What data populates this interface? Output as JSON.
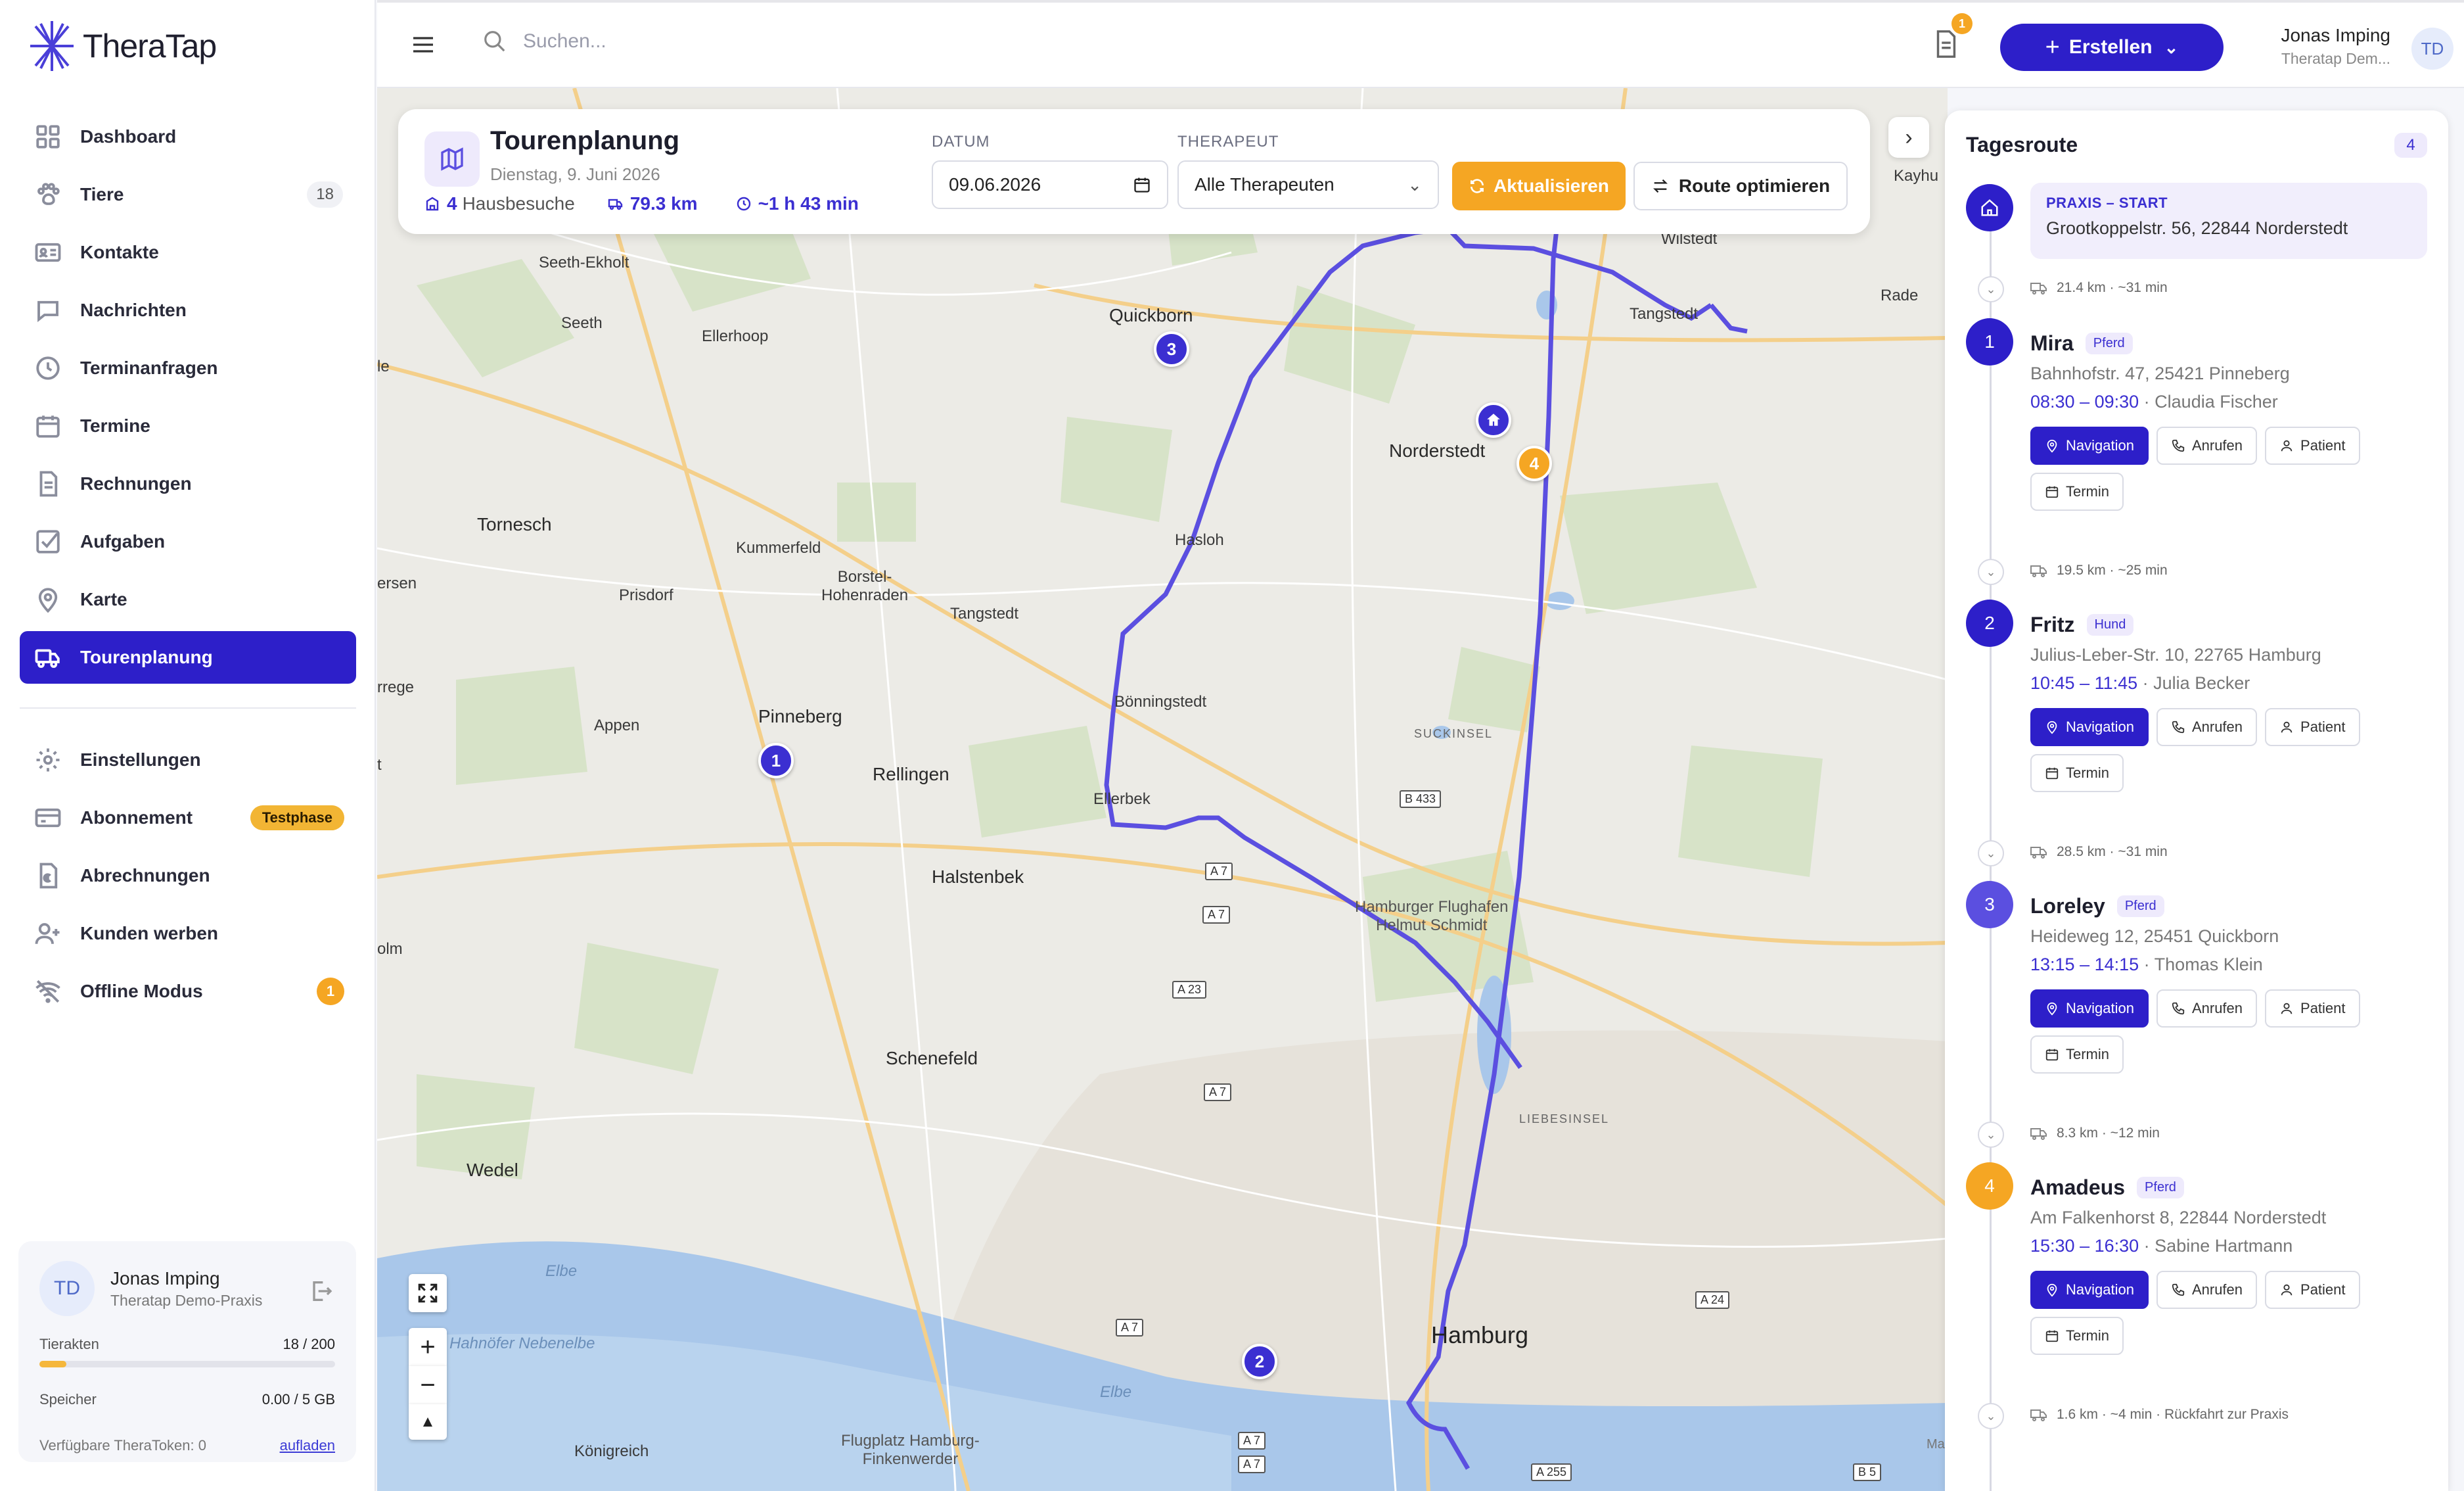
{
  "app": {
    "name": "TheraTap"
  },
  "sidebar": {
    "items": [
      {
        "label": "Dashboard",
        "icon": "grid-icon"
      },
      {
        "label": "Tiere",
        "icon": "paw-icon",
        "count": "18"
      },
      {
        "label": "Kontakte",
        "icon": "contact-card-icon"
      },
      {
        "label": "Nachrichten",
        "icon": "chat-icon"
      },
      {
        "label": "Terminanfragen",
        "icon": "clock-icon"
      },
      {
        "label": "Termine",
        "icon": "calendar-icon"
      },
      {
        "label": "Rechnungen",
        "icon": "invoice-icon"
      },
      {
        "label": "Aufgaben",
        "icon": "checkbox-icon"
      },
      {
        "label": "Karte",
        "icon": "map-pin-icon"
      },
      {
        "label": "Tourenplanung",
        "icon": "truck-icon",
        "active": true
      }
    ],
    "bottom_items": [
      {
        "label": "Einstellungen",
        "icon": "gear-icon"
      },
      {
        "label": "Abonnement",
        "icon": "card-icon",
        "badge": "Testphase"
      },
      {
        "label": "Abrechnungen",
        "icon": "euro-doc-icon"
      },
      {
        "label": "Kunden werben",
        "icon": "add-user-icon"
      },
      {
        "label": "Offline Modus",
        "icon": "wifi-off-icon",
        "badge": "1"
      }
    ],
    "user_card": {
      "initials": "TD",
      "name": "Jonas Imping",
      "org": "Theratap Demo-Praxis",
      "animals_label": "Tierakten",
      "animals_value": "18 / 200",
      "animals_fill": 0.09,
      "storage_label": "Speicher",
      "storage_value": "0.00 / 5 GB",
      "token_label": "Verfügbare TheraToken: 0",
      "token_link": "aufladen"
    }
  },
  "topbar": {
    "search_placeholder": "Suchen...",
    "notification_count": "1",
    "create_label": "Erstellen",
    "user_name": "Jonas Imping",
    "user_org": "Theratap Dem...",
    "user_initials": "TD"
  },
  "tour": {
    "title": "Tourenplanung",
    "date_text": "Dienstag, 9. Juni 2026",
    "visits_count": "4",
    "visits_label": "Hausbesuche",
    "distance": "79.3 km",
    "duration": "~1 h 43 min",
    "date_label": "DATUM",
    "date_value": "09.06.2026",
    "therapist_label": "THERAPEUT",
    "therapist_value": "Alle Therapeuten",
    "refresh_label": "Aktualisieren",
    "optimize_label": "Route optimieren"
  },
  "map": {
    "places": {
      "seeth_ekholt": "Seeth-Ekholt",
      "seeth": "Seeth",
      "ellerhoop": "Ellerhoop",
      "quickborn": "Quickborn",
      "tangstedt_ne": "Tangstedt",
      "wilstedt": "Wilstedt",
      "rade": "Rade",
      "norderstedt": "Norderstedt",
      "tornesch": "Tornesch",
      "kummerfeld": "Kummerfeld",
      "borstel": "Borstel-\nHohenraden",
      "prisdorf": "Prisdorf",
      "tangstedt": "Tangstedt",
      "hasloh": "Hasloh",
      "boenningstedt": "Bönningstedt",
      "pinneberg": "Pinneberg",
      "appen": "Appen",
      "rellingen": "Rellingen",
      "ellerbek": "Ellerbek",
      "suckinsel": "SUCKINSEL",
      "halstenbek": "Halstenbek",
      "airport": "Hamburger Flughafen\nHelmut Schmidt",
      "schenefeld": "Schenefeld",
      "wedel": "Wedel",
      "hamburg": "Hamburg",
      "liebesinsel": "LIEBESINSEL",
      "elbe1": "Elbe",
      "elbe2": "Elbe",
      "nebenelbe": "Hahnöfer Nebenelbe",
      "koenigreich": "Königreich",
      "finkenwerder": "Flugplatz Hamburg-\nFinkenwerder",
      "kayhude": "Kayhu",
      "ersen": "ersen",
      "rrege": "rrege",
      "olm": "olm",
      "le": "le",
      "t": "t",
      "maptiler": "Ma"
    },
    "shields": {
      "b433": "B 433",
      "a7a": "A 7",
      "a7b": "A 7",
      "a23": "A 23",
      "a7c": "A 7",
      "a24": "A 24",
      "a7d": "A 7",
      "a7e": "A 7",
      "a7f": "A 7",
      "a255": "A 255",
      "b5": "B 5"
    },
    "pins": [
      "1",
      "2",
      "3",
      "4"
    ],
    "zoom_in": "+",
    "zoom_out": "−",
    "reset": "▲"
  },
  "route_panel": {
    "title": "Tagesroute",
    "count": "4",
    "start": {
      "label": "PRAXIS – START",
      "address": "Grootkoppelstr. 56, 22844 Norderstedt"
    },
    "legs": [
      "21.4 km · ~31 min",
      "19.5 km · ~25 min",
      "28.5 km · ~31 min",
      "8.3 km · ~12 min",
      "1.6 km · ~4 min · Rückfahrt zur Praxis"
    ],
    "stops": [
      {
        "num": "1",
        "name": "Mira",
        "tag": "Pferd",
        "address": "Bahnhofstr. 47, 25421 Pinneberg",
        "time": "08:30 – 09:30",
        "therapist": "· Claudia Fischer"
      },
      {
        "num": "2",
        "name": "Fritz",
        "tag": "Hund",
        "address": "Julius-Leber-Str. 10, 22765 Hamburg",
        "time": "10:45 – 11:45",
        "therapist": "· Julia Becker"
      },
      {
        "num": "3",
        "name": "Loreley",
        "tag": "Pferd",
        "address": "Heideweg 12, 25451 Quickborn",
        "time": "13:15 – 14:15",
        "therapist": "· Thomas Klein"
      },
      {
        "num": "4",
        "name": "Amadeus",
        "tag": "Pferd",
        "address": "Am Falkenhorst 8, 22844 Norderstedt",
        "time": "15:30 – 16:30",
        "therapist": "· Sabine Hartmann"
      }
    ],
    "buttons": {
      "nav": "Navigation",
      "call": "Anrufen",
      "patient": "Patient",
      "termin": "Termin"
    }
  },
  "colors": {
    "primary": "#2d1fc9",
    "accent": "#f5a623",
    "route": "#5b4fe0"
  }
}
